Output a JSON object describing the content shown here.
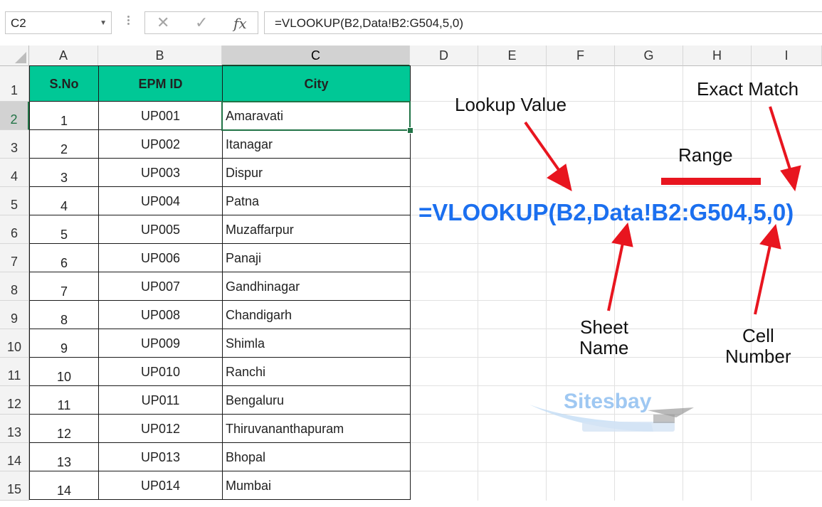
{
  "formula_bar": {
    "name_box": "C2",
    "cancel_icon": "✕",
    "enter_icon": "✓",
    "fx_icon": "fx",
    "formula": "=VLOOKUP(B2,Data!B2:G504,5,0)"
  },
  "columns": [
    "A",
    "B",
    "C",
    "D",
    "E",
    "F",
    "G",
    "H",
    "I"
  ],
  "rows": [
    "1",
    "2",
    "3",
    "4",
    "5",
    "6",
    "7",
    "8",
    "9",
    "10",
    "11",
    "12",
    "13",
    "14",
    "15"
  ],
  "table": {
    "headers": [
      "S.No",
      "EPM ID",
      "City"
    ],
    "records": [
      {
        "sno": "1",
        "id": "UP001",
        "city": "Amaravati"
      },
      {
        "sno": "2",
        "id": "UP002",
        "city": "Itanagar"
      },
      {
        "sno": "3",
        "id": "UP003",
        "city": "Dispur"
      },
      {
        "sno": "4",
        "id": "UP004",
        "city": "Patna"
      },
      {
        "sno": "5",
        "id": "UP005",
        "city": "Muzaffarpur"
      },
      {
        "sno": "6",
        "id": "UP006",
        "city": "Panaji"
      },
      {
        "sno": "7",
        "id": "UP007",
        "city": "Gandhinagar"
      },
      {
        "sno": "8",
        "id": "UP008",
        "city": "Chandigarh"
      },
      {
        "sno": "9",
        "id": "UP009",
        "city": "Shimla"
      },
      {
        "sno": "10",
        "id": "UP010",
        "city": "Ranchi"
      },
      {
        "sno": "11",
        "id": "UP011",
        "city": "Bengaluru"
      },
      {
        "sno": "12",
        "id": "UP012",
        "city": "Thiruvananthapuram"
      },
      {
        "sno": "13",
        "id": "UP013",
        "city": "Bhopal"
      },
      {
        "sno": "14",
        "id": "UP014",
        "city": "Mumbai"
      }
    ]
  },
  "annotation": {
    "formula": "=VLOOKUP(B2,Data!B2:G504,5,0)",
    "lookup_value": "Lookup Value",
    "exact_match": "Exact Match",
    "range": "Range",
    "sheet_name_1": "Sheet",
    "sheet_name_2": "Name",
    "cell_number_1": "Cell",
    "cell_number_2": "Number"
  },
  "watermark": "Sitesbay",
  "colors": {
    "header_fill": "#00c896",
    "formula_blue": "#1b6fef",
    "arrow_red": "#e8151f",
    "excel_green": "#217346"
  }
}
